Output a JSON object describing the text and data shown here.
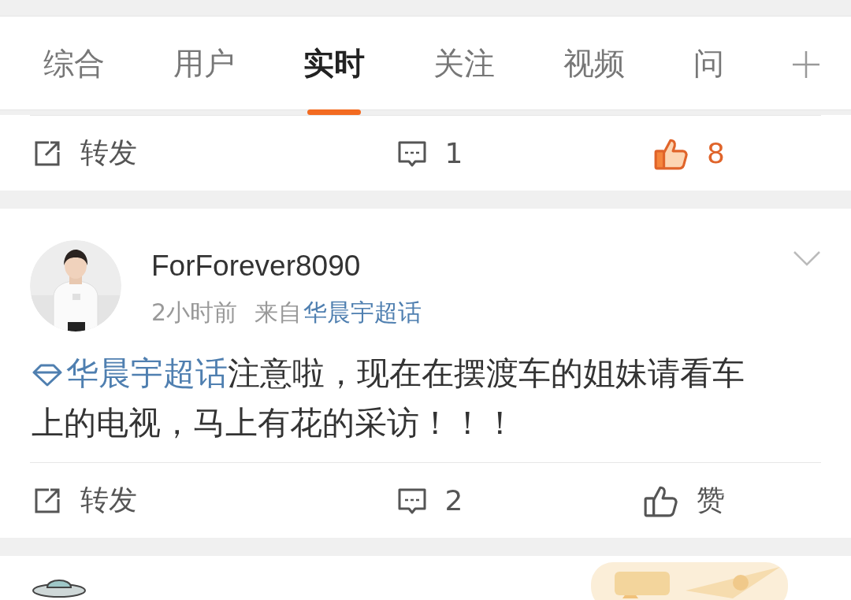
{
  "tabs": [
    {
      "label": "综合",
      "selected": false
    },
    {
      "label": "用户",
      "selected": false
    },
    {
      "label": "实时",
      "selected": true
    },
    {
      "label": "关注",
      "selected": false
    },
    {
      "label": "视频",
      "selected": false
    },
    {
      "label": "问",
      "selected": false
    }
  ],
  "feed": [
    {
      "kind": "actions",
      "actions": [
        {
          "kind": "repost",
          "label": "转发"
        },
        {
          "kind": "comment",
          "label": "1"
        },
        {
          "kind": "like",
          "label": "8",
          "selected": true
        }
      ]
    },
    {
      "kind": "post",
      "user": "ForForever8090",
      "time": "2小时前",
      "source_prefix": "来自",
      "source": "华晨宇超话",
      "topic": "华晨宇超话",
      "body": "注意啦，现在在摆渡车的姐妹请看车上的电视，马上有花的采访！！！",
      "actions": [
        {
          "kind": "repost",
          "label": "转发"
        },
        {
          "kind": "comment",
          "label": "2"
        },
        {
          "kind": "like",
          "label": "赞",
          "selected": false
        }
      ]
    },
    {
      "kind": "partial"
    }
  ]
}
